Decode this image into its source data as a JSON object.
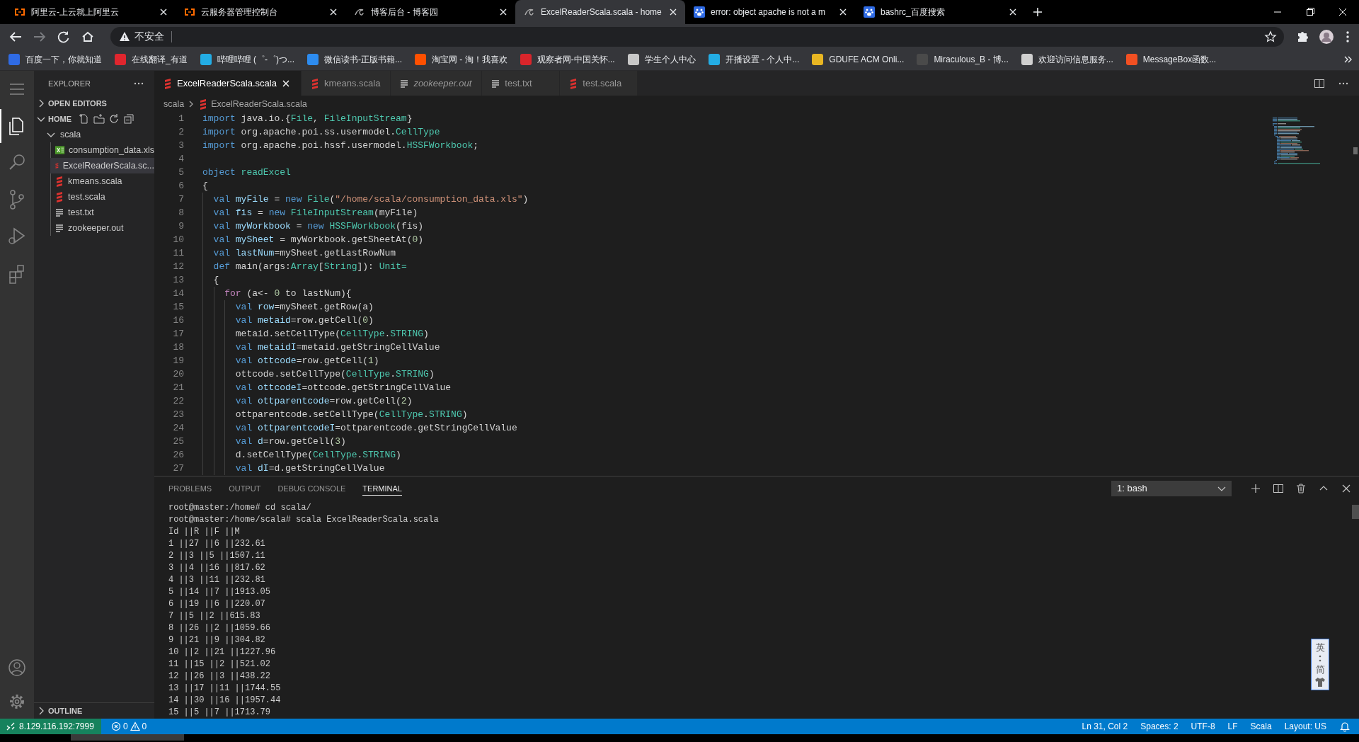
{
  "browser": {
    "tabs": [
      {
        "title": "阿里云-上云就上阿里云",
        "kind": "brackets",
        "selected": false
      },
      {
        "title": "云服务器管理控制台",
        "kind": "brackets",
        "selected": false
      },
      {
        "title": "博客后台 - 博客园",
        "kind": "swirl",
        "selected": false
      },
      {
        "title": "ExcelReaderScala.scala - home",
        "kind": "swirl",
        "selected": true
      },
      {
        "title": "error: object apache is not a m",
        "kind": "paw",
        "selected": false
      },
      {
        "title": "bashrc_百度搜索",
        "kind": "paw",
        "selected": false
      }
    ],
    "address_bar": {
      "security_label": "不安全"
    },
    "bookmarks": [
      {
        "label": "百度一下，你就知道",
        "color": "#2f6be5"
      },
      {
        "label": "在线翻译_有道",
        "color": "#e0262e"
      },
      {
        "label": "哔哩哔哩 (゜-゜)つ...",
        "color": "#23ade5"
      },
      {
        "label": "微信读书-正版书籍...",
        "color": "#2d8cf0"
      },
      {
        "label": "淘宝网 - 淘！我喜欢",
        "color": "#ff5000"
      },
      {
        "label": "观察者网-中国关怀...",
        "color": "#d9252b"
      },
      {
        "label": "学生个人中心",
        "color": "#c8c8c8"
      },
      {
        "label": "开播设置 - 个人中...",
        "color": "#23ade5"
      },
      {
        "label": "GDUFE ACM Onli...",
        "color": "#e8b623"
      },
      {
        "label": "Miraculous_B - 博...",
        "color": "#4a4a4a"
      },
      {
        "label": "欢迎访问信息服务...",
        "color": "#d0d0d0"
      },
      {
        "label": "MessageBox函数...",
        "color": "#f25022"
      }
    ]
  },
  "activity_bar": {
    "top": [
      {
        "kind": "menu",
        "selected": false
      },
      {
        "kind": "explorer",
        "selected": true
      },
      {
        "kind": "search",
        "selected": false
      },
      {
        "kind": "source-control",
        "selected": false
      },
      {
        "kind": "run",
        "selected": false
      },
      {
        "kind": "extensions",
        "selected": false
      }
    ],
    "bottom": [
      {
        "kind": "account",
        "selected": false
      },
      {
        "kind": "settings",
        "selected": false
      }
    ]
  },
  "sidebar": {
    "title": "EXPLORER",
    "sections": [
      {
        "label": "OPEN EDITORS",
        "expanded": false
      },
      {
        "label": "HOME",
        "expanded": true,
        "tree": [
          {
            "label": "scala",
            "expanded": true,
            "selected": false,
            "children": [
              {
                "label": "consumption_data.xls",
                "kind": "excel",
                "selected": false
              },
              {
                "label": "ExcelReaderScala.sc...",
                "kind": "scala",
                "selected": true
              },
              {
                "label": "kmeans.scala",
                "kind": "scala",
                "selected": false
              },
              {
                "label": "test.scala",
                "kind": "scala",
                "selected": false
              },
              {
                "label": "test.txt",
                "kind": "text",
                "selected": false
              },
              {
                "label": "zookeeper.out",
                "kind": "text",
                "selected": false
              }
            ]
          }
        ]
      }
    ],
    "outline": {
      "label": "OUTLINE",
      "expanded": false
    }
  },
  "editor": {
    "tabs": [
      {
        "label": "ExcelReaderScala.scala",
        "kind": "scala",
        "selected": true,
        "preview": false
      },
      {
        "label": "kmeans.scala",
        "kind": "scala",
        "selected": false,
        "preview": false
      },
      {
        "label": "zookeeper.out",
        "kind": "text",
        "selected": false,
        "preview": true
      },
      {
        "label": "test.txt",
        "kind": "text",
        "selected": false,
        "preview": false
      },
      {
        "label": "test.scala",
        "kind": "scala",
        "selected": false,
        "preview": false
      }
    ],
    "breadcrumbs": [
      {
        "label": "scala",
        "kind": "folder"
      },
      {
        "label": "ExcelReaderScala.scala",
        "kind": "scala"
      }
    ],
    "lines": [
      {
        "number": "1",
        "tokens": [
          {
            "kind": "keyword",
            "text": "import"
          },
          {
            "kind": "plain",
            "text": " java.io.{"
          },
          {
            "kind": "type",
            "text": "File"
          },
          {
            "kind": "plain",
            "text": ", "
          },
          {
            "kind": "type",
            "text": "FileInputStream"
          },
          {
            "kind": "plain",
            "text": "}"
          }
        ]
      },
      {
        "number": "2",
        "tokens": [
          {
            "kind": "keyword",
            "text": "import"
          },
          {
            "kind": "plain",
            "text": " org.apache.poi.ss.usermodel."
          },
          {
            "kind": "type",
            "text": "CellType"
          }
        ]
      },
      {
        "number": "3",
        "tokens": [
          {
            "kind": "keyword",
            "text": "import"
          },
          {
            "kind": "plain",
            "text": " org.apache.poi.hssf.usermodel."
          },
          {
            "kind": "type",
            "text": "HSSFWorkbook"
          },
          {
            "kind": "plain",
            "text": ";"
          }
        ]
      },
      {
        "number": "4"
      },
      {
        "number": "5",
        "tokens": [
          {
            "kind": "keyword",
            "text": "object "
          },
          {
            "kind": "type",
            "text": "readExcel"
          }
        ]
      },
      {
        "number": "6",
        "tokens": [
          {
            "kind": "plain",
            "text": "{"
          }
        ]
      },
      {
        "number": "7",
        "tokens": [
          {
            "kind": "keyword",
            "text": "  val "
          },
          {
            "kind": "variable",
            "text": "myFile"
          },
          {
            "kind": "plain",
            "text": " = "
          },
          {
            "kind": "keyword",
            "text": "new "
          },
          {
            "kind": "type",
            "text": "File"
          },
          {
            "kind": "plain",
            "text": "("
          },
          {
            "kind": "string",
            "text": "\"/home/scala/consumption_data.xls\""
          },
          {
            "kind": "plain",
            "text": ")"
          }
        ]
      },
      {
        "number": "8",
        "tokens": [
          {
            "kind": "keyword",
            "text": "  val "
          },
          {
            "kind": "variable",
            "text": "fis"
          },
          {
            "kind": "plain",
            "text": " = "
          },
          {
            "kind": "keyword",
            "text": "new "
          },
          {
            "kind": "type",
            "text": "FileInputStream"
          },
          {
            "kind": "plain",
            "text": "(myFile)"
          }
        ]
      },
      {
        "number": "9",
        "tokens": [
          {
            "kind": "keyword",
            "text": "  val "
          },
          {
            "kind": "variable",
            "text": "myWorkbook"
          },
          {
            "kind": "plain",
            "text": " = "
          },
          {
            "kind": "keyword",
            "text": "new "
          },
          {
            "kind": "type",
            "text": "HSSFWorkbook"
          },
          {
            "kind": "plain",
            "text": "(fis)"
          }
        ]
      },
      {
        "number": "10",
        "tokens": [
          {
            "kind": "keyword",
            "text": "  val "
          },
          {
            "kind": "variable",
            "text": "mySheet"
          },
          {
            "kind": "plain",
            "text": " = myWorkbook.getSheetAt("
          },
          {
            "kind": "number",
            "text": "0"
          },
          {
            "kind": "plain",
            "text": ")"
          }
        ]
      },
      {
        "number": "11",
        "tokens": [
          {
            "kind": "keyword",
            "text": "  val "
          },
          {
            "kind": "variable",
            "text": "lastNum"
          },
          {
            "kind": "plain",
            "text": "=mySheet.getLastRowNum"
          }
        ]
      },
      {
        "number": "12",
        "tokens": [
          {
            "kind": "keyword",
            "text": "  def"
          },
          {
            "kind": "plain",
            "text": " main(args:"
          },
          {
            "kind": "type",
            "text": "Array"
          },
          {
            "kind": "plain",
            "text": "["
          },
          {
            "kind": "type",
            "text": "String"
          },
          {
            "kind": "plain",
            "text": "]): "
          },
          {
            "kind": "type",
            "text": "Unit="
          }
        ]
      },
      {
        "number": "13",
        "tokens": [
          {
            "kind": "plain",
            "text": "  {"
          }
        ]
      },
      {
        "number": "14",
        "tokens": [
          {
            "kind": "control",
            "text": "    for"
          },
          {
            "kind": "plain",
            "text": " (a<- "
          },
          {
            "kind": "number",
            "text": "0"
          },
          {
            "kind": "plain",
            "text": " to lastNum){"
          }
        ]
      },
      {
        "number": "15",
        "tokens": [
          {
            "kind": "keyword",
            "text": "      val "
          },
          {
            "kind": "variable",
            "text": "row"
          },
          {
            "kind": "plain",
            "text": "=mySheet.getRow(a)"
          }
        ]
      },
      {
        "number": "16",
        "tokens": [
          {
            "kind": "keyword",
            "text": "      val "
          },
          {
            "kind": "variable",
            "text": "metaid"
          },
          {
            "kind": "plain",
            "text": "=row.getCell("
          },
          {
            "kind": "number",
            "text": "0"
          },
          {
            "kind": "plain",
            "text": ")"
          }
        ]
      },
      {
        "number": "17",
        "tokens": [
          {
            "kind": "plain",
            "text": "      metaid.setCellType("
          },
          {
            "kind": "type",
            "text": "CellType"
          },
          {
            "kind": "plain",
            "text": "."
          },
          {
            "kind": "type",
            "text": "STRING"
          },
          {
            "kind": "plain",
            "text": ")"
          }
        ]
      },
      {
        "number": "18",
        "tokens": [
          {
            "kind": "keyword",
            "text": "      val "
          },
          {
            "kind": "variable",
            "text": "metaidI"
          },
          {
            "kind": "plain",
            "text": "=metaid.getStringCellValue"
          }
        ]
      },
      {
        "number": "19",
        "tokens": [
          {
            "kind": "keyword",
            "text": "      val "
          },
          {
            "kind": "variable",
            "text": "ottcode"
          },
          {
            "kind": "plain",
            "text": "=row.getCell("
          },
          {
            "kind": "number",
            "text": "1"
          },
          {
            "kind": "plain",
            "text": ")"
          }
        ]
      },
      {
        "number": "20",
        "tokens": [
          {
            "kind": "plain",
            "text": "      ottcode.setCellType("
          },
          {
            "kind": "type",
            "text": "CellType"
          },
          {
            "kind": "plain",
            "text": "."
          },
          {
            "kind": "type",
            "text": "STRING"
          },
          {
            "kind": "plain",
            "text": ")"
          }
        ]
      },
      {
        "number": "21",
        "tokens": [
          {
            "kind": "keyword",
            "text": "      val "
          },
          {
            "kind": "variable",
            "text": "ottcodeI"
          },
          {
            "kind": "plain",
            "text": "=ottcode.getStringCellValue"
          }
        ]
      },
      {
        "number": "22",
        "tokens": [
          {
            "kind": "keyword",
            "text": "      val "
          },
          {
            "kind": "variable",
            "text": "ottparentcode"
          },
          {
            "kind": "plain",
            "text": "=row.getCell("
          },
          {
            "kind": "number",
            "text": "2"
          },
          {
            "kind": "plain",
            "text": ")"
          }
        ]
      },
      {
        "number": "23",
        "tokens": [
          {
            "kind": "plain",
            "text": "      ottparentcode.setCellType("
          },
          {
            "kind": "type",
            "text": "CellType"
          },
          {
            "kind": "plain",
            "text": "."
          },
          {
            "kind": "type",
            "text": "STRING"
          },
          {
            "kind": "plain",
            "text": ")"
          }
        ]
      },
      {
        "number": "24",
        "tokens": [
          {
            "kind": "keyword",
            "text": "      val "
          },
          {
            "kind": "variable",
            "text": "ottparentcodeI"
          },
          {
            "kind": "plain",
            "text": "=ottparentcode.getStringCellValue"
          }
        ]
      },
      {
        "number": "25",
        "tokens": [
          {
            "kind": "keyword",
            "text": "      val "
          },
          {
            "kind": "variable",
            "text": "d"
          },
          {
            "kind": "plain",
            "text": "=row.getCell("
          },
          {
            "kind": "number",
            "text": "3"
          },
          {
            "kind": "plain",
            "text": ")"
          }
        ]
      },
      {
        "number": "26",
        "tokens": [
          {
            "kind": "plain",
            "text": "      d.setCellType("
          },
          {
            "kind": "type",
            "text": "CellType"
          },
          {
            "kind": "plain",
            "text": "."
          },
          {
            "kind": "type",
            "text": "STRING"
          },
          {
            "kind": "plain",
            "text": ")"
          }
        ]
      },
      {
        "number": "27",
        "tokens": [
          {
            "kind": "keyword",
            "text": "      val "
          },
          {
            "kind": "variable",
            "text": "dI"
          },
          {
            "kind": "plain",
            "text": "=d.getStringCellValue"
          }
        ]
      }
    ]
  },
  "panel": {
    "tabs": [
      {
        "label": "PROBLEMS",
        "selected": false
      },
      {
        "label": "OUTPUT",
        "selected": false
      },
      {
        "label": "DEBUG CONSOLE",
        "selected": false
      },
      {
        "label": "TERMINAL",
        "selected": true
      }
    ],
    "terminal_select": "1: bash",
    "terminal_lines": [
      "root@master:/home# cd scala/",
      "root@master:/home/scala# scala ExcelReaderScala.scala",
      "Id ||R ||F ||M",
      "1 ||27 ||6 ||232.61",
      "2 ||3 ||5 ||1507.11",
      "3 ||4 ||16 ||817.62",
      "4 ||3 ||11 ||232.81",
      "5 ||14 ||7 ||1913.05",
      "6 ||19 ||6 ||220.07",
      "7 ||5 ||2 ||615.83",
      "8 ||26 ||2 ||1059.66",
      "9 ||21 ||9 ||304.82",
      "10 ||2 ||21 ||1227.96",
      "11 ||15 ||2 ||521.02",
      "12 ||26 ||3 ||438.22",
      "13 ||17 ||11 ||1744.55",
      "14 ||30 ||16 ||1957.44",
      "15 ||5 ||7 ||1713.79"
    ]
  },
  "ime_toolbar": {
    "labels": [
      "英",
      "简"
    ]
  },
  "status_bar": {
    "remote": "8.129.116.192:7999",
    "errors": "0",
    "warnings": "0",
    "items": [
      "Ln 31, Col 2",
      "Spaces: 2",
      "UTF-8",
      "LF",
      "Scala",
      "Layout: US"
    ]
  }
}
